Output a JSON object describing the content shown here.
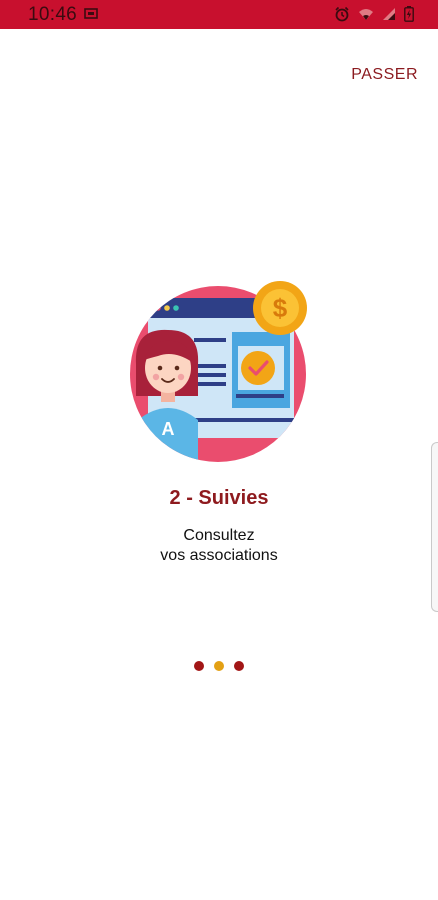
{
  "status_bar": {
    "time": "10:46",
    "icons": [
      "screen-icon",
      "alarm-icon",
      "wifi-icon",
      "signal-icon",
      "battery-charging-icon"
    ],
    "color": "#c8102e"
  },
  "top": {
    "skip_label": "PASSER"
  },
  "slide": {
    "illustration": "person-with-web-page-and-coin",
    "badge_letter": "A",
    "coin_symbol": "$",
    "title": "2 - Suivies",
    "description_line1": "Consultez",
    "description_line2": "vos associations"
  },
  "pager": {
    "total": 3,
    "active_index": 1,
    "colors": {
      "active": "#e3a014",
      "inactive": "#a21616"
    }
  },
  "colors": {
    "accent": "#8e1a1e",
    "circle": "#ea4d6e",
    "coin": "#f2a516"
  }
}
